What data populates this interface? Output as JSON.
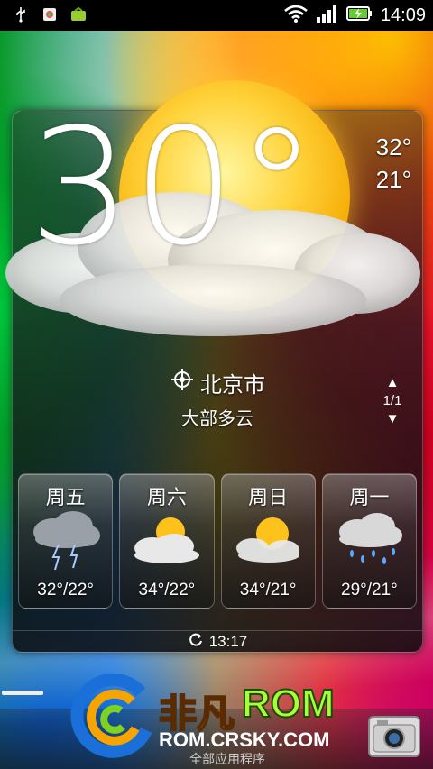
{
  "statusbar": {
    "time": "14:09",
    "left_icons": [
      "usb-icon",
      "app-notification-icon",
      "android-icon"
    ],
    "right_icons": [
      "wifi-icon",
      "signal-icon",
      "battery-charging-icon"
    ]
  },
  "weather": {
    "current_temp": "30°",
    "high": "32°",
    "low": "21°",
    "city": "北京市",
    "condition": "大部多云",
    "page_indicator": "1/1",
    "updated_time": "13:17"
  },
  "forecast": [
    {
      "day": "周五",
      "temp": "32°/22°",
      "icon": "thunderstorm-icon"
    },
    {
      "day": "周六",
      "temp": "34°/22°",
      "icon": "partly-cloudy-icon"
    },
    {
      "day": "周日",
      "temp": "34°/21°",
      "icon": "partly-cloudy-icon"
    },
    {
      "day": "周一",
      "temp": "29°/21°",
      "icon": "rain-icon"
    }
  ],
  "dock": {
    "all_apps_label": "全部应用程序"
  },
  "watermark": {
    "brand_cn": "非凡",
    "brand_rom": "ROM",
    "url": "ROM.CRSKY.COM"
  }
}
